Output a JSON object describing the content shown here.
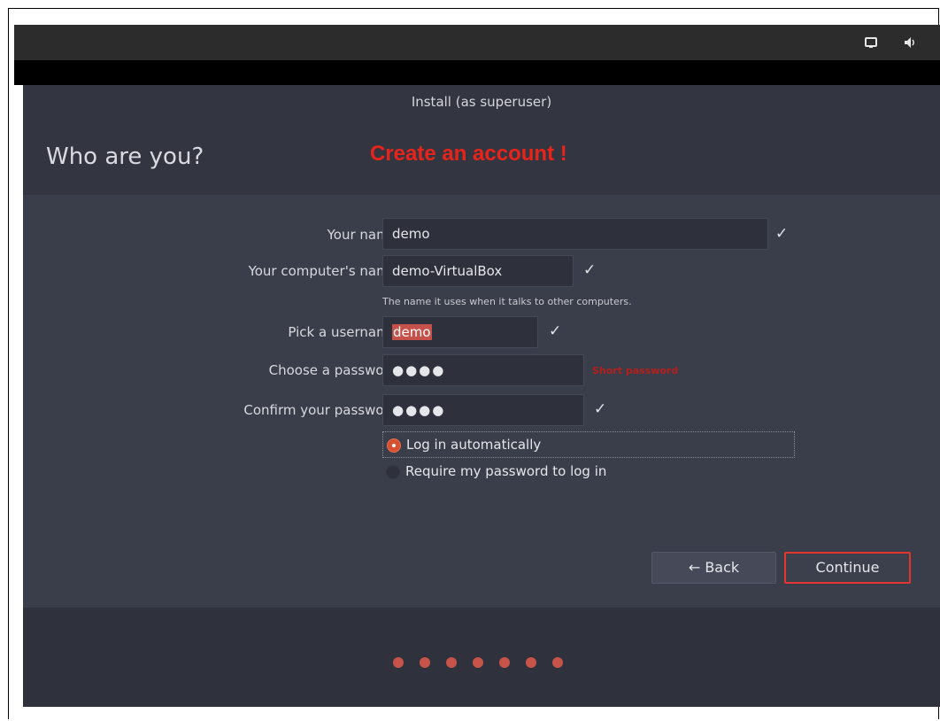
{
  "topbar": {
    "icons": [
      "display-icon",
      "volume-icon"
    ]
  },
  "header": {
    "window_title": "Install (as superuser)",
    "heading": "Who are you?",
    "annotation": "Create an account !"
  },
  "form": {
    "name": {
      "label": "Your name:",
      "value": "demo"
    },
    "computer": {
      "label": "Your computer's name:",
      "value": "demo-VirtualBox",
      "hint": "The name it uses when it talks to other computers."
    },
    "username": {
      "label": "Pick a username:",
      "value": "demo"
    },
    "password": {
      "label": "Choose a password:",
      "value": "●●●●",
      "strength": "Short password"
    },
    "confirm": {
      "label": "Confirm your password:",
      "value": "●●●●"
    },
    "check_mark": "✓",
    "login_options": [
      {
        "label": "Log in automatically",
        "selected": true
      },
      {
        "label": "Require my password to log in",
        "selected": false
      }
    ]
  },
  "buttons": {
    "back": "← Back",
    "continue": "Continue"
  },
  "progress": {
    "total_steps": 7
  },
  "colors": {
    "accent": "#e2352e",
    "annotation": "#e8241a",
    "progress_dot": "#c7544b"
  }
}
